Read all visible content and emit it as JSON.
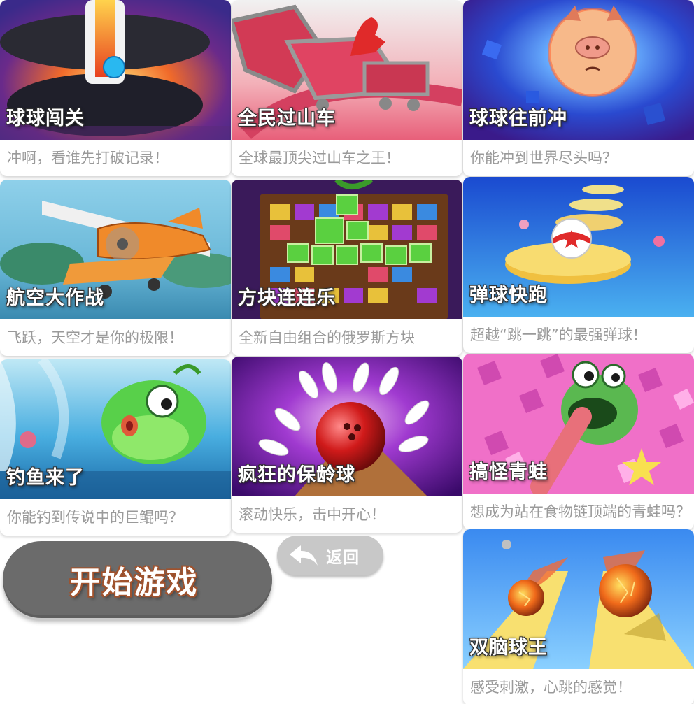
{
  "games": [
    {
      "title": "球球闯关",
      "desc": "冲啊，看谁先打破记录！",
      "theme": "tower-ball"
    },
    {
      "title": "全民过山车",
      "desc": "全球最顶尖过山车之王！",
      "theme": "roller-coaster"
    },
    {
      "title": "球球往前冲",
      "desc": "你能冲到世界尽头吗？",
      "theme": "pig-ball"
    },
    {
      "title": "航空大作战",
      "desc": "飞跃，天空才是你的极限！",
      "theme": "airplane"
    },
    {
      "title": "方块连连乐",
      "desc": "全新自由组合的俄罗斯方块",
      "theme": "jewel-blocks"
    },
    {
      "title": "弹球快跑",
      "desc": "超越“跳一跳”的最强弹球！",
      "theme": "bounce-ball"
    },
    {
      "title": "钓鱼来了",
      "desc": "你能钓到传说中的巨鲲吗？",
      "theme": "fishing"
    },
    {
      "title": "疯狂的保龄球",
      "desc": "滚动快乐，击中开心！",
      "theme": "bowling"
    },
    {
      "title": "搞怪青蛙",
      "desc": "想成为站在食物链顶端的青蛙吗？",
      "theme": "frog"
    },
    {
      "title": "双脑球王",
      "desc": "感受刺激，心跳的感觉！",
      "theme": "twin-balls"
    }
  ],
  "buttons": {
    "start_label": "开始游戏",
    "back_label": "返回"
  },
  "colors": {
    "card_desc": "#9a9a9a",
    "start_button": "#6b6b6b",
    "back_button": "#c8c8c8",
    "start_text_outline": "#a0522d"
  }
}
